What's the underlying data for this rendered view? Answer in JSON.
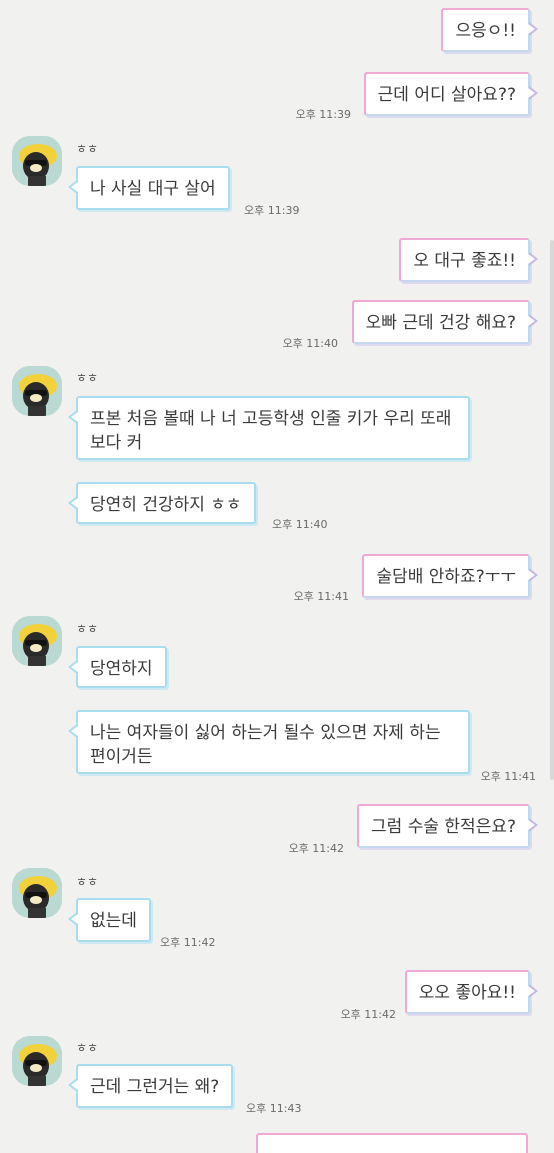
{
  "sender_name": "ㅎㅎ",
  "messages": [
    {
      "side": "right",
      "text": "으응ㅇ!!"
    },
    {
      "side": "right",
      "text": "근데 어디 살아요??",
      "time": "오후 11:39"
    },
    {
      "side": "left",
      "text": "나 사실 대구 살어",
      "time": "오후 11:39"
    },
    {
      "side": "right",
      "text": "오 대구 좋죠!!"
    },
    {
      "side": "right",
      "text": "오빠 근데 건강 해요?",
      "time": "오후 11:40"
    },
    {
      "side": "left",
      "text": "프본 처음 볼때 나 너 고등학생 인줄 키가 우리 또래 보다 커"
    },
    {
      "side": "left",
      "text": "당연히 건강하지 ㅎㅎ",
      "time": "오후 11:40"
    },
    {
      "side": "right",
      "text": "술담배 안하죠?ㅜㅜ",
      "time": "오후 11:41"
    },
    {
      "side": "left",
      "text": "당연하지"
    },
    {
      "side": "left",
      "text": "나는 여자들이 싫어 하는거 될수 있으면 자제 하는 편이거든",
      "time": "오후 11:41"
    },
    {
      "side": "right",
      "text": "그럼 수술 한적은요?",
      "time": "오후 11:42"
    },
    {
      "side": "left",
      "text": "없는데",
      "time": "오후 11:42"
    },
    {
      "side": "right",
      "text": "오오 좋아요!!",
      "time": "오후 11:42"
    },
    {
      "side": "left",
      "text": "근데 그런거는 왜?",
      "time": "오후 11:43"
    }
  ],
  "colors": {
    "background": "#f1f1ef",
    "left_border": "#a9dcef",
    "right_border": "#f0a9d4"
  },
  "icons": {
    "avatar": "friend-avatar-sunglasses-character"
  }
}
